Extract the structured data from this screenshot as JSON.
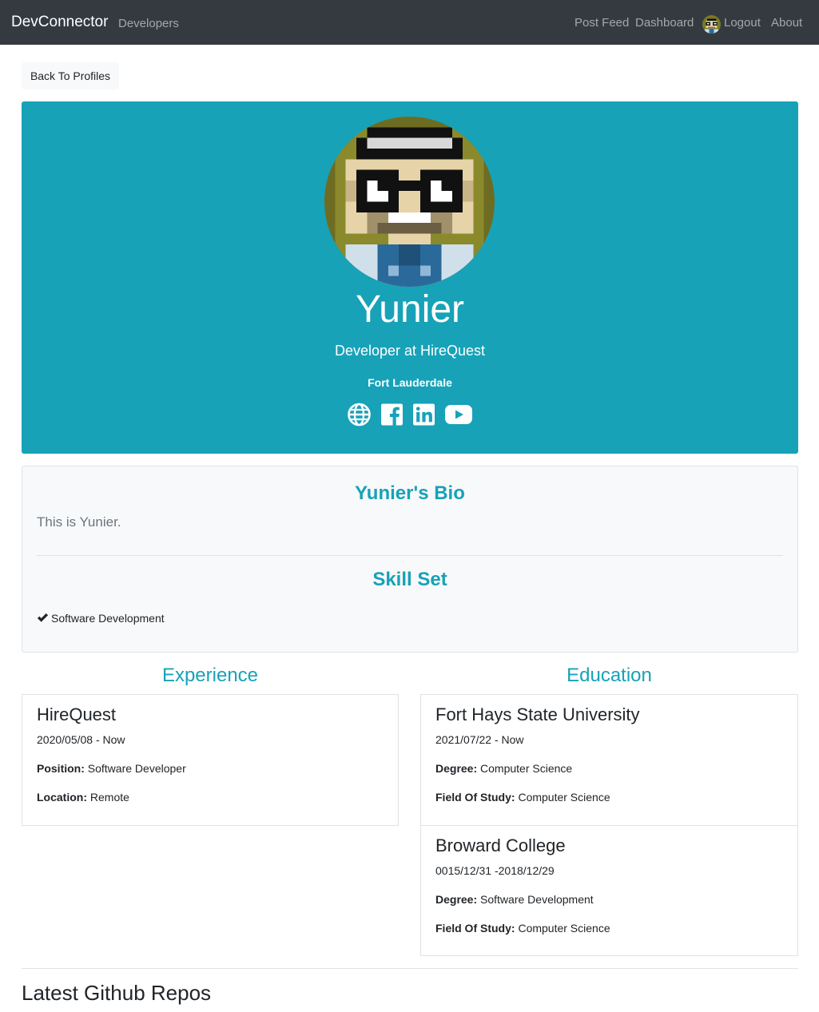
{
  "navbar": {
    "brand": "DevConnector",
    "developers": "Developers",
    "post_feed": "Post Feed",
    "dashboard": "Dashboard",
    "logout": "Logout",
    "about": "About",
    "bg_color": "#343a40"
  },
  "back_button": "Back To Profiles",
  "profile": {
    "name": "Yunier",
    "status": "Developer at HireQuest",
    "location": "Fort Lauderdale",
    "social_icons": [
      "globe-icon",
      "facebook-icon",
      "linkedin-icon",
      "youtube-icon"
    ],
    "accent_color": "#17a2b8"
  },
  "about": {
    "bio_heading": "Yunier's Bio",
    "bio_text": "This is Yunier.",
    "skills_heading": "Skill Set",
    "skills": [
      "Software Development"
    ]
  },
  "experience": {
    "heading": "Experience",
    "items": [
      {
        "company": "HireQuest",
        "dates": "2020/05/08 - Now",
        "position_label": "Position:",
        "position": " Software Developer",
        "location_label": "Location:",
        "location": " Remote"
      }
    ]
  },
  "education": {
    "heading": "Education",
    "items": [
      {
        "school": "Fort Hays State University",
        "dates": "2021/07/22 - Now",
        "degree_label": "Degree:",
        "degree": " Computer Science",
        "field_label": "Field Of Study:",
        "field": " Computer Science"
      },
      {
        "school": "Broward College",
        "dates": "0015/12/31 -2018/12/29",
        "degree_label": "Degree:",
        "degree": " Software Development",
        "field_label": "Field Of Study:",
        "field": " Computer Science"
      }
    ]
  },
  "github": {
    "heading": "Latest Github Repos"
  }
}
